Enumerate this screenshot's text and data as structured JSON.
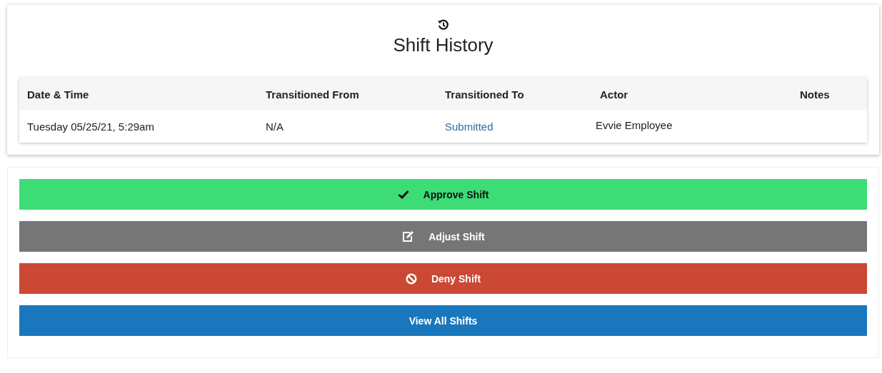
{
  "history": {
    "title": "Shift History",
    "columns": [
      "Date & Time",
      "Transitioned From",
      "Transitioned To",
      "Actor",
      "Notes"
    ],
    "rows": [
      {
        "cells": [
          {
            "kind": "text",
            "text": "Tuesday 05/25/21, 5:29am"
          },
          {
            "kind": "text",
            "text": "N/A"
          },
          {
            "kind": "link",
            "text": "Submitted"
          },
          {
            "kind": "text",
            "text": "Evvie Employee"
          }
        ]
      }
    ]
  },
  "actions": [
    {
      "kind": "approve",
      "label": "Approve Shift"
    },
    {
      "kind": "adjust",
      "label": "Adjust Shift"
    },
    {
      "kind": "deny",
      "label": "Deny Shift"
    },
    {
      "kind": "view",
      "label": "View All Shifts"
    }
  ]
}
